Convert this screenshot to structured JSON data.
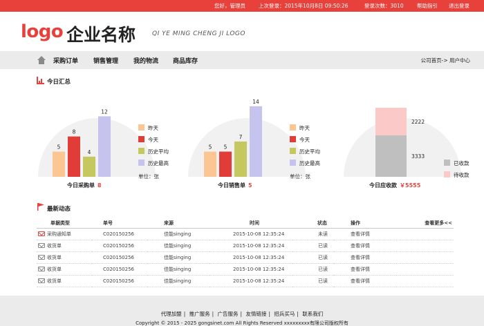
{
  "topbar": {
    "greeting": "您好，管理员",
    "last_login_label": "上次登录：2015年10月8日 09:50:26",
    "login_count_label": "登录次数：3010",
    "help": "帮助指引",
    "logout": "退出登录"
  },
  "brand": {
    "logo": "logo",
    "name": "企业名称",
    "subtitle": "QI YE MING CHENG JI LOGO"
  },
  "nav": {
    "items": [
      "采购订单",
      "销售管理",
      "我的物流",
      "商品库存"
    ],
    "breadcrumb": "公司首页-> 用户中心"
  },
  "summary": {
    "title": "今日汇总",
    "unit_label": "单位：张",
    "legend": [
      "昨天",
      "今天",
      "历史平均",
      "历史最高"
    ],
    "purchase_caption": "今日采购单",
    "purchase_count": "8",
    "sales_caption": "今日销售单",
    "sales_count": "5",
    "receivable_caption": "今日应收款",
    "receivable_amount": "￥5555",
    "receivable_legend": [
      "已收款",
      "待收款"
    ]
  },
  "colors": {
    "brand_red": "#e8403b",
    "yesterday": "#fbc692",
    "today": "#e23c38",
    "history_avg": "#c5c75f",
    "history_max": "#c7c3ef",
    "received": "#bfbfbf",
    "pending": "#fcc9c9",
    "chart_bg": "#f1f1f1"
  },
  "chart_data": [
    {
      "type": "bar",
      "title": "今日采购单",
      "categories": [
        "昨天",
        "今天",
        "历史平均",
        "历史最高"
      ],
      "values": [
        5,
        8,
        4,
        12
      ],
      "ylim": [
        0,
        14
      ]
    },
    {
      "type": "bar",
      "title": "今日销售单",
      "categories": [
        "昨天",
        "今天",
        "历史平均",
        "历史最高"
      ],
      "values": [
        5,
        5,
        7,
        14
      ],
      "ylim": [
        0,
        14
      ]
    },
    {
      "type": "bar",
      "title": "今日应收款",
      "categories": [
        "已收款",
        "待收款"
      ],
      "values": [
        3333,
        2222
      ],
      "stacked": true,
      "ylim": [
        0,
        5555
      ]
    }
  ],
  "messages": {
    "title": "最新动态",
    "more": "查看更多<<",
    "headers": [
      "单据类型",
      "单号",
      "来源",
      "时间",
      "状态",
      "操作"
    ],
    "rows": [
      {
        "type": "采购通知单",
        "no": "C020150256",
        "source": "佳能singing",
        "time": "2015-10-08 12:35:24",
        "status": "未读",
        "action": "查看详情",
        "unread": true
      },
      {
        "type": "收货单",
        "no": "C020150256",
        "source": "佳能singing",
        "time": "2015-10-08 12:35:24",
        "status": "已读",
        "action": "查看详情",
        "unread": false
      },
      {
        "type": "收货单",
        "no": "C020150256",
        "source": "佳能singing",
        "time": "2015-10-08 12:35:24",
        "status": "已读",
        "action": "查看详情",
        "unread": false
      },
      {
        "type": "收货单",
        "no": "C020150256",
        "source": "佳能singing",
        "time": "2015-10-08 12:35:24",
        "status": "已读",
        "action": "查看详情",
        "unread": false
      },
      {
        "type": "收货单",
        "no": "C020150256",
        "source": "佳能singing",
        "time": "2015-10-08 12:35:24",
        "status": "已读",
        "action": "查看详情",
        "unread": false
      }
    ]
  },
  "footer": {
    "links": [
      "代理加盟",
      "推广服务",
      "广告服务",
      "友情链接",
      "招兵买马",
      "联系我们"
    ],
    "copyright": "Copyright © 2015 - 2025 gongsinet.com All Rights Reserved  xxxxxxxxx有限公司版权所有"
  }
}
